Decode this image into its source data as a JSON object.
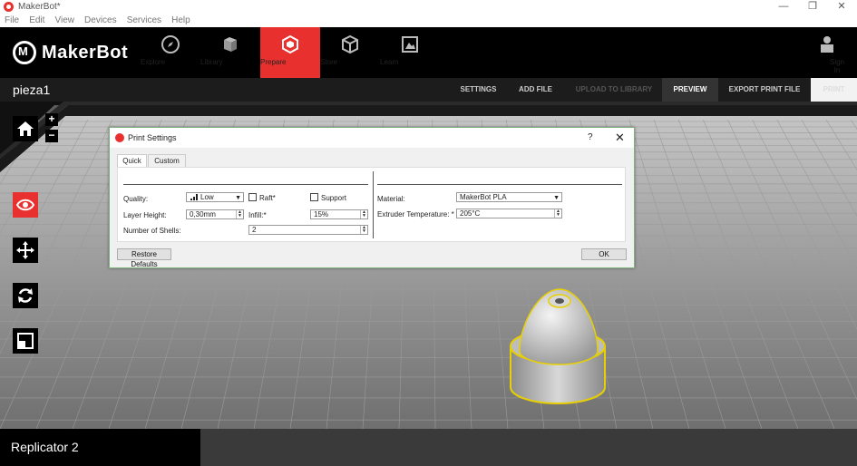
{
  "window": {
    "title": "MakerBot*",
    "minimize": "—",
    "maximize": "❐",
    "close": "✕"
  },
  "menu": [
    "File",
    "Edit",
    "View",
    "Devices",
    "Services",
    "Help"
  ],
  "nav": {
    "brand": "MakerBot",
    "items": [
      {
        "label": "Explore",
        "icon": "compass-icon"
      },
      {
        "label": "Library",
        "icon": "library-icon"
      },
      {
        "label": "Prepare",
        "icon": "prepare-icon",
        "active": true
      },
      {
        "label": "Store",
        "icon": "box-icon"
      },
      {
        "label": "Learn",
        "icon": "learn-icon"
      }
    ],
    "signin": "Sign In"
  },
  "subbar": {
    "filename": "pieza1",
    "settings": "SETTINGS",
    "add_file": "ADD FILE",
    "upload": "UPLOAD TO LIBRARY",
    "preview": "PREVIEW",
    "export": "EXPORT PRINT FILE",
    "print": "PRINT"
  },
  "tools": {
    "zoom_in": "+",
    "zoom_out": "−"
  },
  "dialog": {
    "title": "Print Settings",
    "help": "?",
    "close": "✕",
    "tabs": [
      "Quick",
      "Custom"
    ],
    "quality_label": "Quality:",
    "quality_value": "Low",
    "raft_label": "Raft*",
    "support_label": "Support",
    "layer_height_label": "Layer Height:",
    "layer_height_value": "0,30mm",
    "infill_label": "Infill:*",
    "infill_value": "15%",
    "shells_label": "Number of Shells:",
    "shells_value": "2",
    "material_label": "Material:",
    "material_value": "MakerBot PLA",
    "extruder_label": "Extruder Temperature: *",
    "extruder_value": "205°C",
    "restore_defaults": "Restore Defaults",
    "ok": "OK"
  },
  "bottom": {
    "printer": "Replicator 2"
  }
}
